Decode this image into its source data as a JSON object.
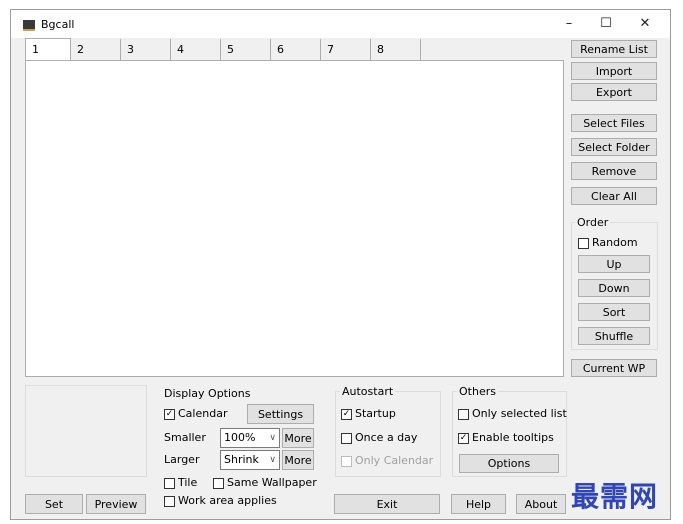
{
  "window": {
    "title": "Bgcall",
    "minimize": "–",
    "maximize": "☐",
    "close": "✕"
  },
  "tabs": [
    "1",
    "2",
    "3",
    "4",
    "5",
    "6",
    "7",
    "8"
  ],
  "right_panel": {
    "rename_list": "Rename List",
    "import": "Import",
    "export": "Export",
    "select_files": "Select Files",
    "select_folder": "Select Folder",
    "remove": "Remove",
    "clear_all": "Clear All",
    "order_label": "Order",
    "random": "Random",
    "up": "Up",
    "down": "Down",
    "sort": "Sort",
    "shuffle": "Shuffle",
    "current_wp": "Current WP"
  },
  "preview": {
    "set": "Set",
    "preview": "Preview"
  },
  "display_options": {
    "label": "Display Options",
    "calendar": "Calendar",
    "settings": "Settings",
    "smaller_label": "Smaller",
    "smaller_value": "100%",
    "larger_label": "Larger",
    "larger_value": "Shrink",
    "more": "More",
    "tile": "Tile",
    "same_wallpaper": "Same Wallpaper",
    "work_area": "Work area applies"
  },
  "autostart": {
    "label": "Autostart",
    "startup": "Startup",
    "once_a_day": "Once a day",
    "only_calendar": "Only Calendar"
  },
  "others": {
    "label": "Others",
    "only_selected": "Only selected list",
    "enable_tooltips": "Enable tooltips",
    "options": "Options"
  },
  "bottom": {
    "exit": "Exit",
    "help": "Help",
    "about": "About"
  },
  "watermark": "最需网",
  "checked_mark": "✓"
}
